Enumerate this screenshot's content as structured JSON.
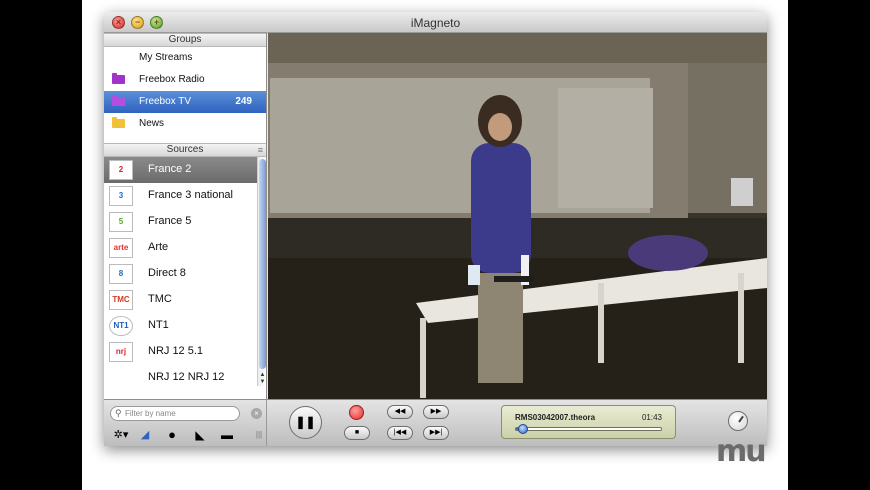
{
  "window": {
    "title": "iMagneto"
  },
  "groups_header": "Groups",
  "groups": [
    {
      "label": "My Streams",
      "icon": "none",
      "count": ""
    },
    {
      "label": "Freebox Radio",
      "icon": "folder-purple-icon",
      "count": ""
    },
    {
      "label": "Freebox TV",
      "icon": "folder-purple-icon",
      "count": "249",
      "selected": true
    },
    {
      "label": "News",
      "icon": "folder-yellow-icon",
      "count": ""
    }
  ],
  "sources_header": "Sources",
  "sources": [
    {
      "label": "France 2",
      "logo": "2",
      "selected": true
    },
    {
      "label": "France 3 national",
      "logo": "3"
    },
    {
      "label": "France 5",
      "logo": "5"
    },
    {
      "label": "Arte",
      "logo": "arte"
    },
    {
      "label": "Direct 8",
      "logo": "8"
    },
    {
      "label": "TMC",
      "logo": "TMC"
    },
    {
      "label": "NT1",
      "logo": "NT1"
    },
    {
      "label": "NRJ 12 5.1",
      "logo": "nrj"
    },
    {
      "label": "NRJ 12 NRJ 12",
      "logo": ""
    }
  ],
  "filter": {
    "placeholder": "Filter by name"
  },
  "player": {
    "filename": "RMS03042007.theora",
    "time": "01:43",
    "progress": 0.03
  },
  "colors": {
    "selection_blue": "#2f63c0",
    "lcd": "#dde1bd"
  },
  "watermark": "mu"
}
